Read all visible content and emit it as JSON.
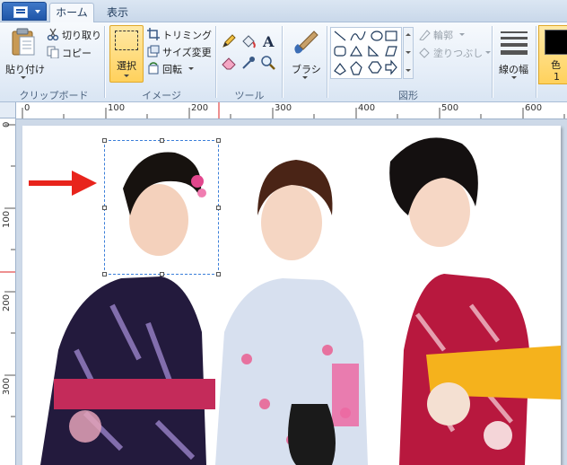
{
  "app": {
    "tabs": {
      "home": "ホーム",
      "view": "表示"
    }
  },
  "ribbon": {
    "clipboard": {
      "paste_label": "貼り付け",
      "cut_label": "切り取り",
      "copy_label": "コピー",
      "group_label": "クリップボード"
    },
    "image": {
      "select_label": "選択",
      "crop_label": "トリミング",
      "resize_label": "サイズ変更",
      "rotate_label": "回転",
      "group_label": "イメージ"
    },
    "tools": {
      "group_label": "ツール"
    },
    "brushes": {
      "label": "ブラシ"
    },
    "shapes": {
      "outline_label": "輪郭",
      "fill_label": "塗りつぶし",
      "group_label": "図形"
    },
    "size": {
      "label": "線の幅"
    },
    "colors": {
      "color1_label": "色",
      "color1_num": "1",
      "accent": "#1f56a8"
    }
  },
  "rulers": {
    "top_ticks": [
      "0",
      "100",
      "200",
      "300",
      "400",
      "500",
      "600"
    ],
    "left_ticks": [
      "0",
      "100",
      "200",
      "300"
    ]
  },
  "canvas": {
    "image_description_icon": "photo-three-women-yukata",
    "annotation_arrow_color": "#e8241c",
    "selection_color": "#3b7fd9"
  }
}
